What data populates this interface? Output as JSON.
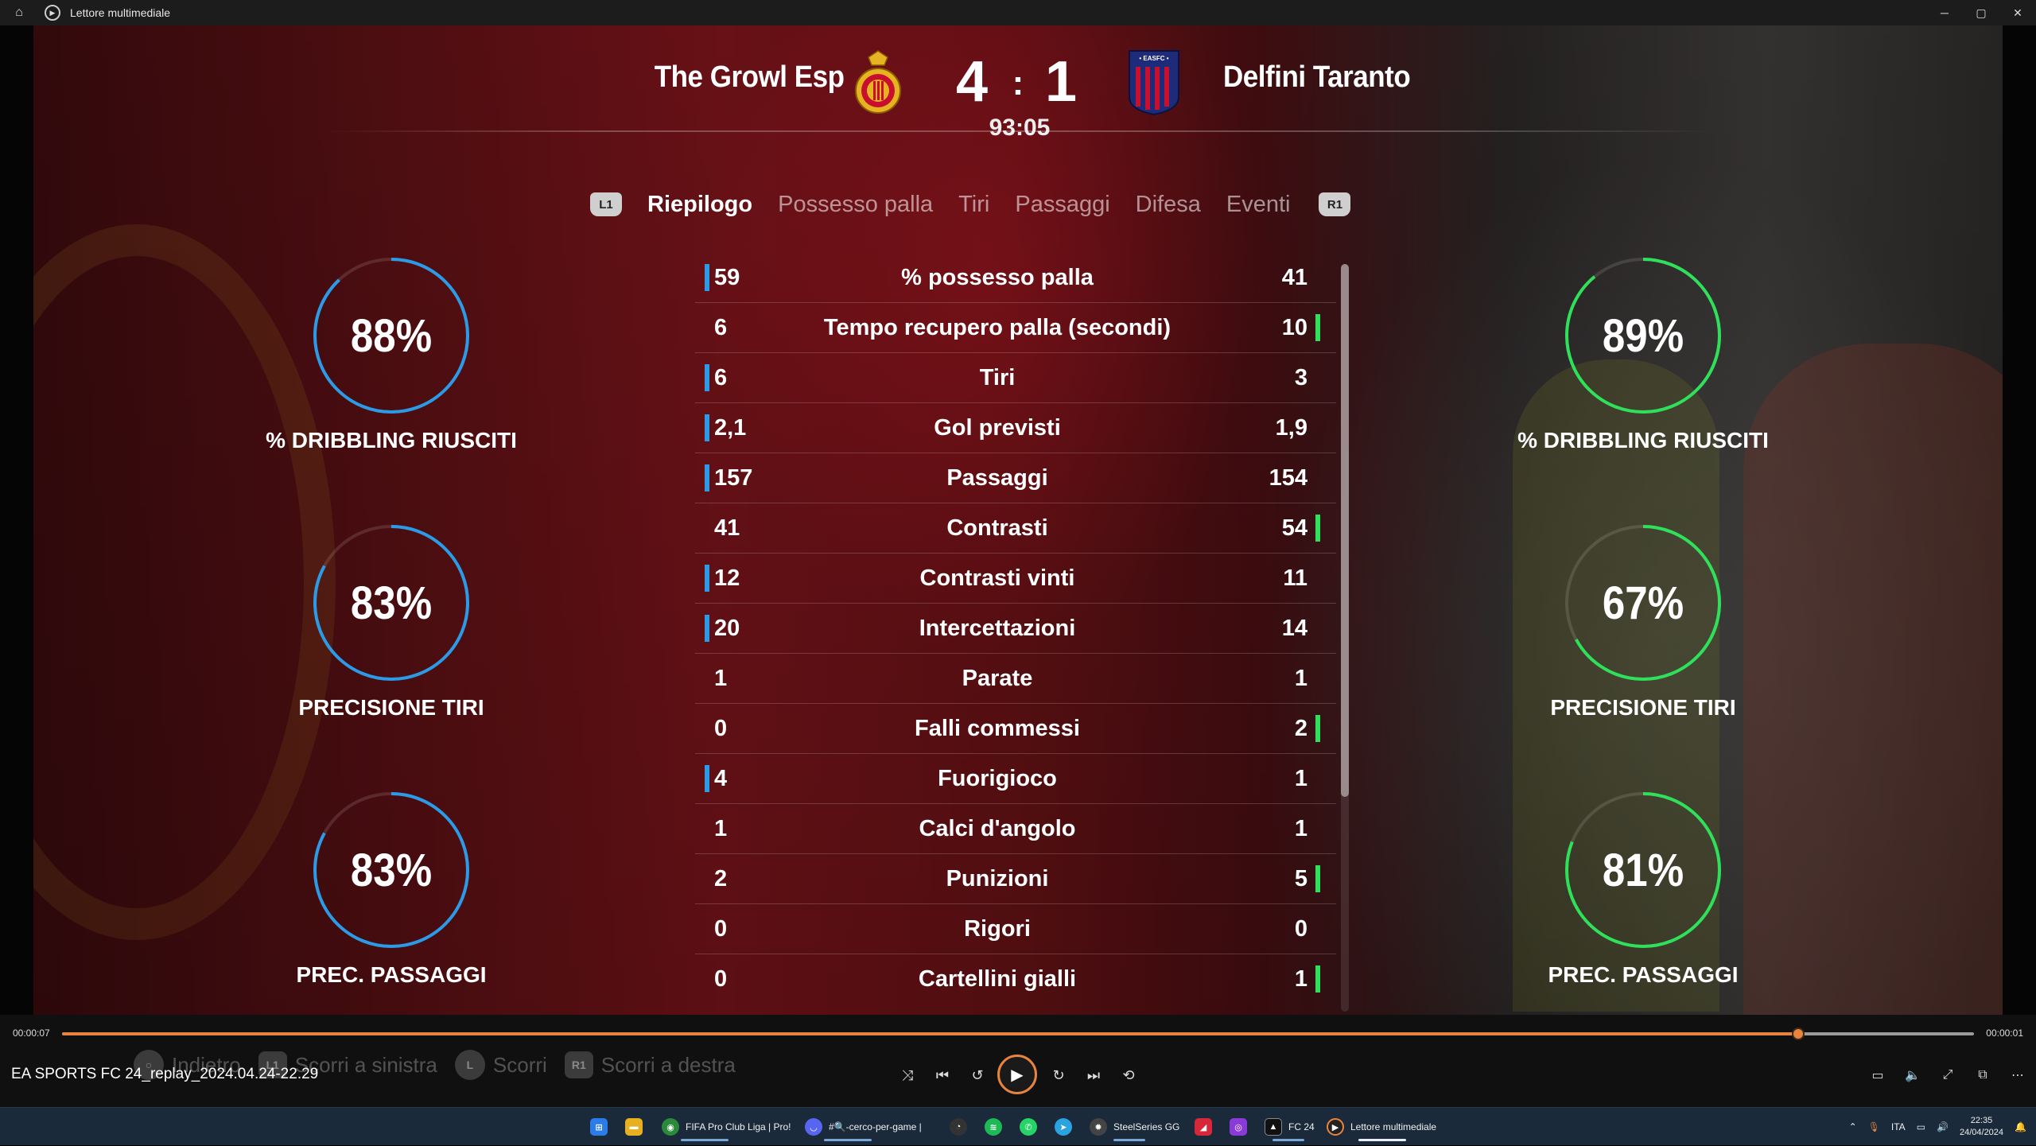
{
  "window": {
    "title": "Lettore multimediale",
    "minimize": "─",
    "maximize": "▢",
    "close": "✕"
  },
  "match": {
    "home_team": "The Growl Esp",
    "away_team": "Delfini Taranto",
    "home_score": "4",
    "separator": ":",
    "away_score": "1",
    "clock": "93:05",
    "away_crest_text": "• EASFC •",
    "colors": {
      "home_bar": "#2b9be8",
      "away_bar": "#2ee05a"
    }
  },
  "tabs": {
    "left_hint": "L1",
    "right_hint": "R1",
    "items": [
      "Riepilogo",
      "Possesso palla",
      "Tiri",
      "Passaggi",
      "Difesa",
      "Eventi"
    ],
    "active": "Riepilogo"
  },
  "rings": {
    "home": [
      {
        "value": "88%",
        "fraction": 0.88,
        "label": "% DRIBBLING RIUSCITI"
      },
      {
        "value": "83%",
        "fraction": 0.83,
        "label": "PRECISIONE TIRI"
      },
      {
        "value": "83%",
        "fraction": 0.83,
        "label": "PREC. PASSAGGI"
      }
    ],
    "away": [
      {
        "value": "89%",
        "fraction": 0.89,
        "label": "% DRIBBLING RIUSCITI"
      },
      {
        "value": "67%",
        "fraction": 0.67,
        "label": "PRECISIONE TIRI"
      },
      {
        "value": "81%",
        "fraction": 0.81,
        "label": "PREC. PASSAGGI"
      }
    ]
  },
  "stats": [
    {
      "home": "59",
      "label": "% possesso palla",
      "away": "41",
      "lead": "home"
    },
    {
      "home": "6",
      "label": "Tempo recupero palla (secondi)",
      "away": "10",
      "lead": "away"
    },
    {
      "home": "6",
      "label": "Tiri",
      "away": "3",
      "lead": "home"
    },
    {
      "home": "2,1",
      "label": "Gol previsti",
      "away": "1,9",
      "lead": "home"
    },
    {
      "home": "157",
      "label": "Passaggi",
      "away": "154",
      "lead": "home"
    },
    {
      "home": "41",
      "label": "Contrasti",
      "away": "54",
      "lead": "away"
    },
    {
      "home": "12",
      "label": "Contrasti vinti",
      "away": "11",
      "lead": "home"
    },
    {
      "home": "20",
      "label": "Intercettazioni",
      "away": "14",
      "lead": "home"
    },
    {
      "home": "1",
      "label": "Parate",
      "away": "1",
      "lead": "none"
    },
    {
      "home": "0",
      "label": "Falli commessi",
      "away": "2",
      "lead": "away"
    },
    {
      "home": "4",
      "label": "Fuorigioco",
      "away": "1",
      "lead": "home"
    },
    {
      "home": "1",
      "label": "Calci d'angolo",
      "away": "1",
      "lead": "none"
    },
    {
      "home": "2",
      "label": "Punizioni",
      "away": "5",
      "lead": "away"
    },
    {
      "home": "0",
      "label": "Rigori",
      "away": "0",
      "lead": "none"
    },
    {
      "home": "0",
      "label": "Cartellini gialli",
      "away": "1",
      "lead": "away"
    }
  ],
  "player": {
    "time_elapsed": "00:00:07",
    "time_remaining": "00:00:01",
    "progress": 0.908,
    "filename": "EA SPORTS FC 24_replay_2024.04.24-22.29",
    "accent": "#e8843c",
    "ghost_hints": [
      {
        "key": "",
        "label": "Indietro"
      },
      {
        "key": "L1",
        "label": "Scorri a sinistra"
      },
      {
        "key": "L",
        "label": "Scorri"
      },
      {
        "key": "R1",
        "label": "Scorri a destra"
      }
    ]
  },
  "taskbar": {
    "items": [
      {
        "icon": "windows-icon",
        "label": ""
      },
      {
        "icon": "file-explorer-icon",
        "label": ""
      },
      {
        "icon": "chrome-icon",
        "label": "FIFA Pro Club Liga | Pro!"
      },
      {
        "icon": "discord-icon",
        "label": "#🔍-cerco-per-game |"
      },
      {
        "icon": "steelseries-small-icon",
        "label": ""
      },
      {
        "icon": "spotify-icon",
        "label": ""
      },
      {
        "icon": "whatsapp-icon",
        "label": ""
      },
      {
        "icon": "telegram-icon",
        "label": ""
      },
      {
        "icon": "steelseries-gg-icon",
        "label": "SteelSeries GG"
      },
      {
        "icon": "red-app-icon",
        "label": ""
      },
      {
        "icon": "purple-app-icon",
        "label": ""
      },
      {
        "icon": "ea-fc-icon",
        "label": "FC 24"
      },
      {
        "icon": "media-player-icon",
        "label": "Lettore multimediale"
      }
    ],
    "tray": {
      "language": "ITA",
      "time": "22:35",
      "date": "24/04/2024"
    }
  }
}
